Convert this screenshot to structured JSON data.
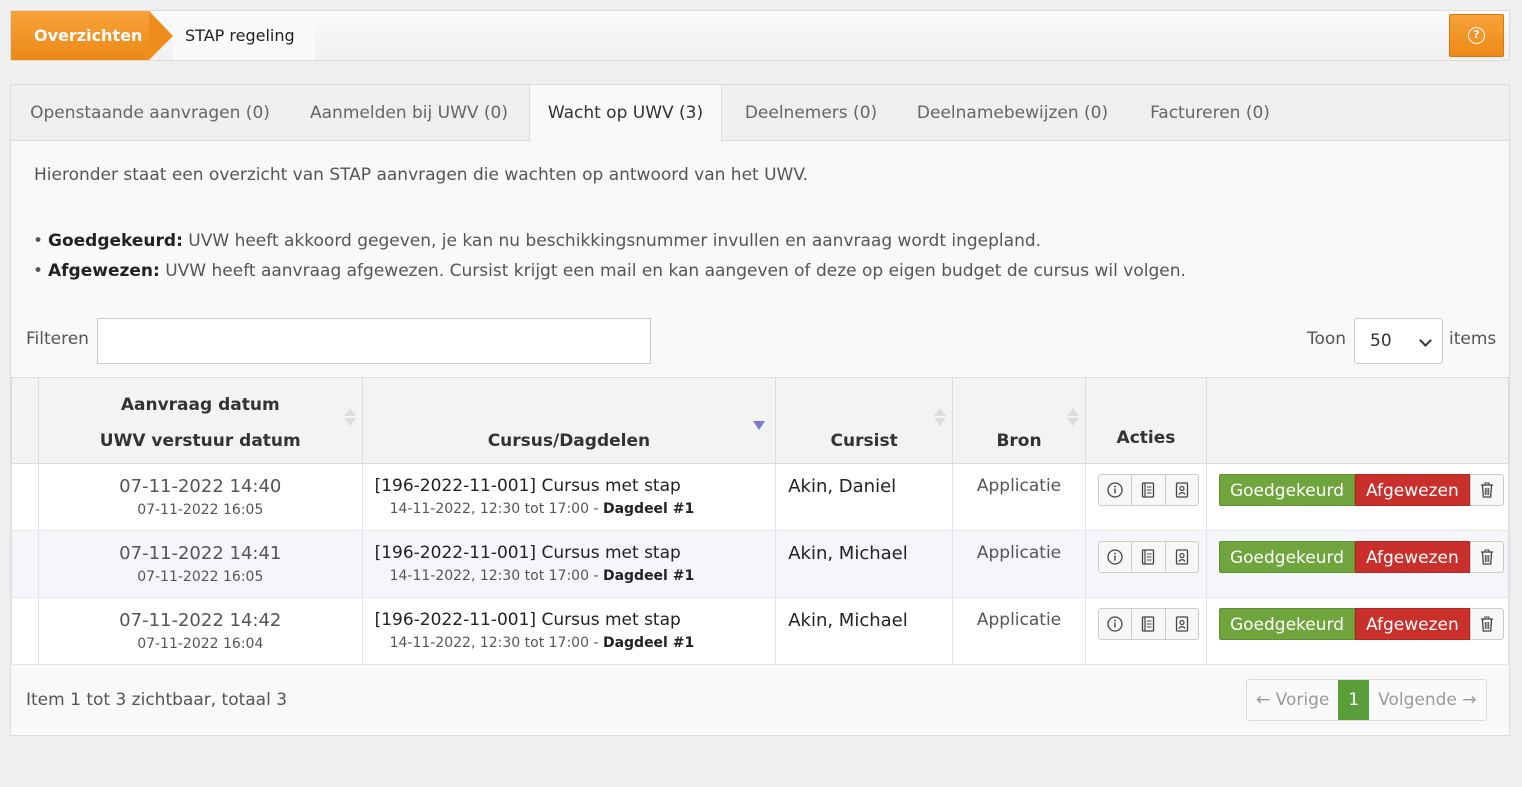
{
  "breadcrumb": {
    "home": "Overzichten",
    "current": "STAP regeling"
  },
  "tabs": [
    {
      "label": "Openstaande aanvragen (0)"
    },
    {
      "label": "Aanmelden bij UWV (0)"
    },
    {
      "label": "Wacht op UWV (3)",
      "active": true
    },
    {
      "label": "Deelnemers (0)"
    },
    {
      "label": "Deelnamebewijzen (0)"
    },
    {
      "label": "Factureren (0)"
    }
  ],
  "intro": "Hieronder staat een overzicht van STAP aanvragen die wachten op antwoord van het UWV.",
  "bullets": [
    {
      "term": "Goedgekeurd:",
      "text": " UVW heeft akkoord gegeven, je kan nu beschikkingsnummer invullen en aanvraag wordt ingepland."
    },
    {
      "term": "Afgewezen:",
      "text": " UVW heeft aanvraag afgewezen. Cursist krijgt een mail en kan aangeven of deze op eigen budget de cursus wil volgen."
    }
  ],
  "filter": {
    "label": "Filteren",
    "value": ""
  },
  "pagesize": {
    "label": "Toon",
    "value": "50",
    "suffix": "items"
  },
  "columns": {
    "date1": "Aanvraag datum",
    "date2": "UWV verstuur datum",
    "course": "Cursus/Dagdelen",
    "cursist": "Cursist",
    "bron": "Bron",
    "acties": "Acties"
  },
  "rows": [
    {
      "date": "07-11-2022 14:40",
      "uwv_date": "07-11-2022 16:05",
      "course": "[196-2022-11-001] Cursus met stap",
      "course_time": "14-11-2022, 12:30 tot 17:00 - ",
      "dagdeel": "Dagdeel #1",
      "cursist": "Akin, Daniel",
      "bron": "Applicatie"
    },
    {
      "date": "07-11-2022 14:41",
      "uwv_date": "07-11-2022 16:05",
      "course": "[196-2022-11-001] Cursus met stap",
      "course_time": "14-11-2022, 12:30 tot 17:00 - ",
      "dagdeel": "Dagdeel #1",
      "cursist": "Akin, Michael",
      "bron": "Applicatie"
    },
    {
      "date": "07-11-2022 14:42",
      "uwv_date": "07-11-2022 16:04",
      "course": "[196-2022-11-001] Cursus met stap",
      "course_time": "14-11-2022, 12:30 tot 17:00 - ",
      "dagdeel": "Dagdeel #1",
      "cursist": "Akin, Michael",
      "bron": "Applicatie"
    }
  ],
  "buttons": {
    "approve": "Goedgekeurd",
    "reject": "Afgewezen"
  },
  "summary": "Item 1 tot 3 zichtbaar, totaal 3",
  "pager": {
    "prev": "← Vorige",
    "current": "1",
    "next": "Volgende →"
  },
  "colors": {
    "accent": "#ec8a17",
    "approve": "#6fa53c",
    "reject": "#c9302c",
    "page_active": "#5a9e3a"
  }
}
